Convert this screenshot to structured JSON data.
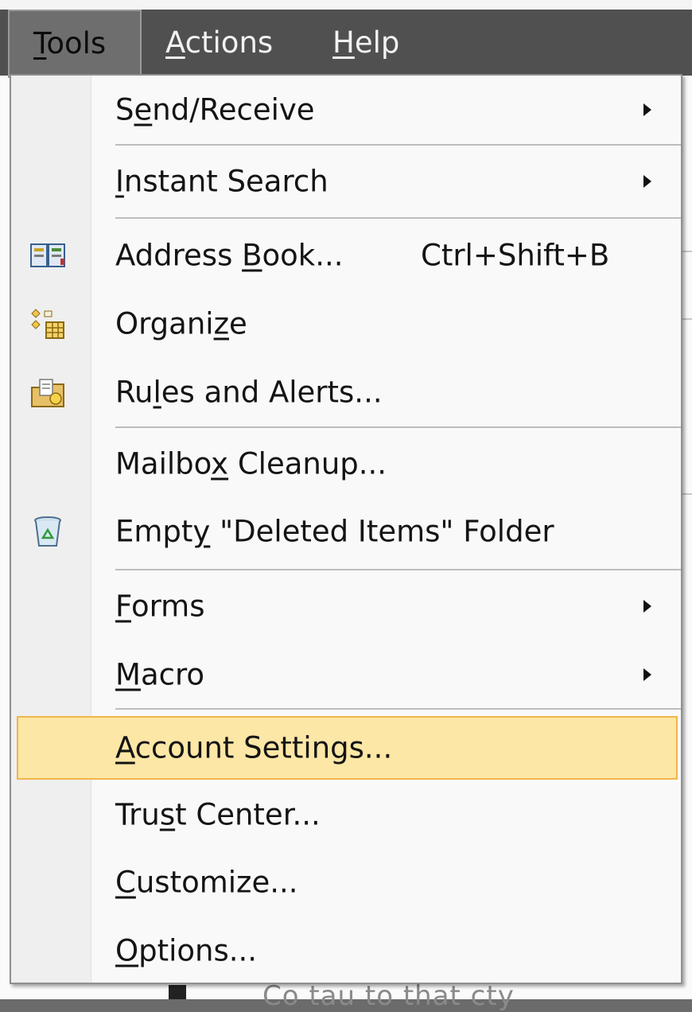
{
  "menubar": {
    "items": [
      {
        "pre": "",
        "u": "T",
        "post": "ools"
      },
      {
        "pre": "",
        "u": "A",
        "post": "ctions"
      },
      {
        "pre": "",
        "u": "H",
        "post": "elp"
      }
    ]
  },
  "menu": {
    "send_receive": {
      "pre": "S",
      "u": "e",
      "post": "nd/Receive"
    },
    "instant_search": {
      "pre": "",
      "u": "I",
      "post": "nstant Search"
    },
    "address_book": {
      "pre": "Address ",
      "u": "B",
      "post": "ook...",
      "shortcut": "Ctrl+Shift+B",
      "icon": "address-book-icon"
    },
    "organize": {
      "pre": "Organi",
      "u": "z",
      "post": "e",
      "icon": "organize-icon"
    },
    "rules_alerts": {
      "pre": "Ru",
      "u": "l",
      "post": "es and Alerts...",
      "icon": "rules-alerts-icon"
    },
    "mailbox_cleanup": {
      "pre": "Mailbo",
      "u": "x",
      "post": " Cleanup..."
    },
    "empty_deleted": {
      "pre": "Empt",
      "u": "y",
      "post": " \"Deleted Items\" Folder",
      "icon": "recycle-bin-icon"
    },
    "forms": {
      "pre": "",
      "u": "F",
      "post": "orms"
    },
    "macro": {
      "pre": "",
      "u": "M",
      "post": "acro"
    },
    "account_settings": {
      "pre": "",
      "u": "A",
      "post": "ccount Settings..."
    },
    "trust_center": {
      "pre": "Tru",
      "u": "s",
      "post": "t Center..."
    },
    "customize": {
      "pre": "",
      "u": "C",
      "post": "ustomize..."
    },
    "options": {
      "pre": "",
      "u": "O",
      "post": "ptions..."
    }
  },
  "background": {
    "bottom_text": "Co tau to that cty"
  },
  "colors": {
    "highlight_fill": "#fde7a6",
    "highlight_border": "#f0b64a",
    "menubar": "#505050"
  }
}
